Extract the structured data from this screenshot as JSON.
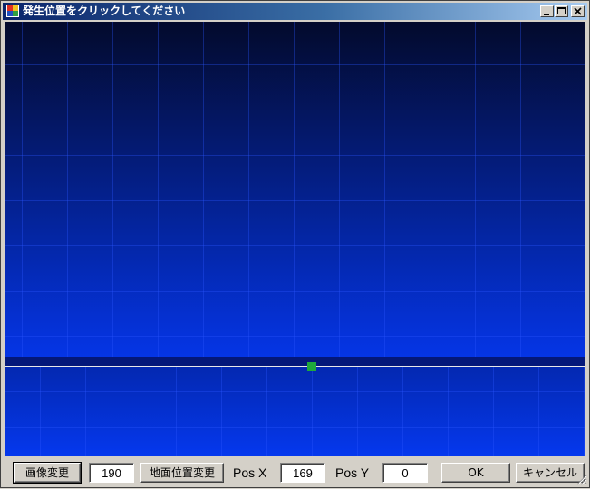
{
  "window": {
    "title": "発生位置をクリックしてください",
    "controls": [
      "minimize-icon",
      "maximize-icon",
      "close-icon"
    ]
  },
  "viewport": {
    "background_top": "#030a2c",
    "background_bottom": "#0535e6",
    "ground_band_color": "#04187a",
    "ground_line_color": "#e8e8e8",
    "marker_color": "#1fa83c"
  },
  "toolbar": {
    "image_change_label": "画像変更",
    "image_value": "190",
    "ground_change_label": "地面位置変更",
    "pos_x_label": "Pos X",
    "pos_x_value": "169",
    "pos_y_label": "Pos Y",
    "pos_y_value": "0",
    "ok_label": "OK",
    "cancel_label": "キャンセル"
  }
}
